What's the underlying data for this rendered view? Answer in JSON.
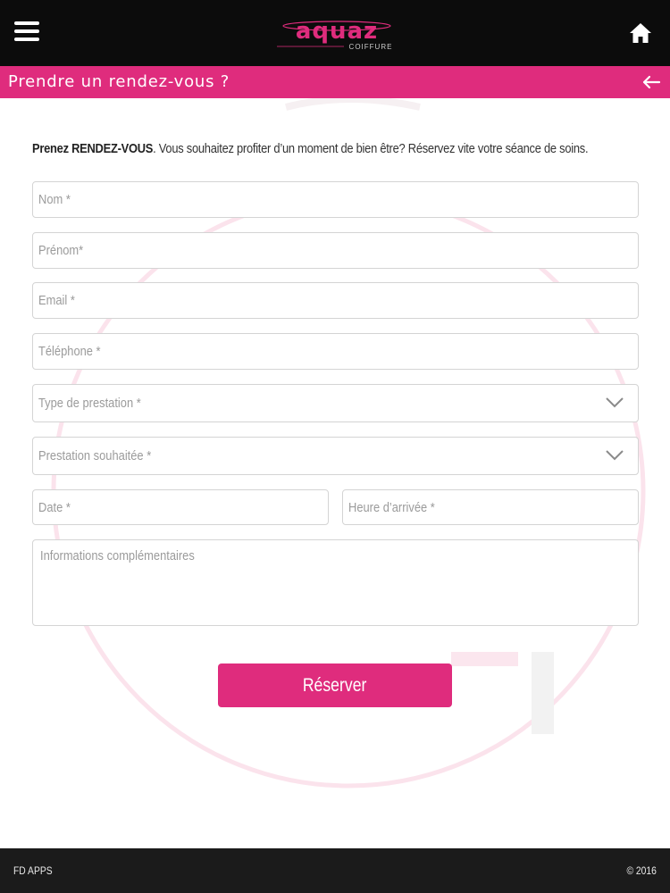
{
  "header": {
    "logo_text": "aquaz",
    "logo_subtext": "COIFFURE",
    "menu_icon": "hamburger-menu-icon",
    "home_icon": "home-icon"
  },
  "titlebar": {
    "title": "Prendre un rendez-vous ?",
    "back_icon": "arrow-left-icon"
  },
  "intro": {
    "bold": "Prenez RENDEZ-VOUS",
    "text": ". Vous souhaitez profiter d’un moment de bien être? Réservez vite votre séance de soins."
  },
  "form": {
    "nom": "Nom *",
    "prenom": "Prénom*",
    "email": "Email *",
    "telephone": "Téléphone *",
    "type_prestation": "Type de prestation *",
    "prestation_souhaitee": "Prestation souhaitée *",
    "date": "Date *",
    "heure": "Heure d’arrivée *",
    "informations": "Informations complémentaires",
    "submit": "Réserver"
  },
  "footer": {
    "left": "FD APPS",
    "right": "© 2016"
  },
  "colors": {
    "accent": "#df2c7d",
    "header_bg": "#0c0c0c",
    "footer_bg": "#1b1b1b"
  }
}
